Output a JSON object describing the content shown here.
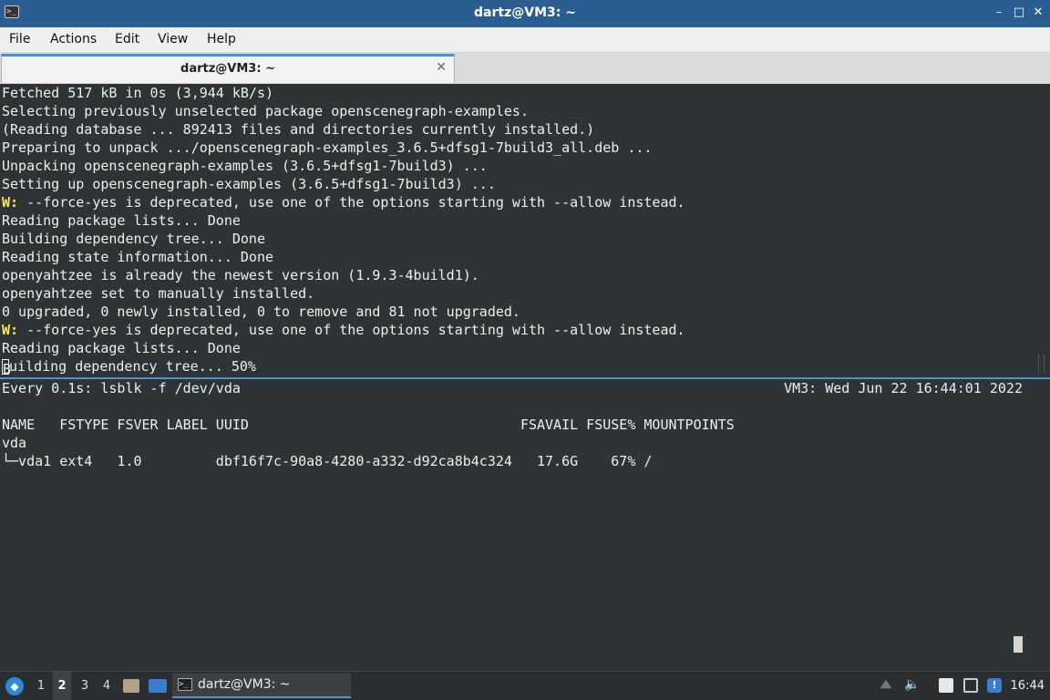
{
  "window": {
    "title": "dartz@VM3: ~",
    "minimize": "–",
    "maximize": "□",
    "close": "✕"
  },
  "menu": [
    "File",
    "Actions",
    "Edit",
    "View",
    "Help"
  ],
  "tab": {
    "label": "dartz@VM3: ~",
    "close": "✕"
  },
  "top_pane": {
    "lines": [
      {
        "text": "Fetched 517 kB in 0s (3,944 kB/s)"
      },
      {
        "text": "Selecting previously unselected package openscenegraph-examples."
      },
      {
        "text": "(Reading database ... 892413 files and directories currently installed.)"
      },
      {
        "text": "Preparing to unpack .../openscenegraph-examples_3.6.5+dfsg1-7build3_all.deb ..."
      },
      {
        "text": "Unpacking openscenegraph-examples (3.6.5+dfsg1-7build3) ..."
      },
      {
        "text": "Setting up openscenegraph-examples (3.6.5+dfsg1-7build3) ..."
      },
      {
        "prefix": "W:",
        "text": " --force-yes is deprecated, use one of the options starting with --allow instead."
      },
      {
        "text": "Reading package lists... Done"
      },
      {
        "text": "Building dependency tree... Done"
      },
      {
        "text": "Reading state information... Done"
      },
      {
        "text": "openyahtzee is already the newest version (1.9.3-4build1)."
      },
      {
        "text": "openyahtzee set to manually installed."
      },
      {
        "text": "0 upgraded, 0 newly installed, 0 to remove and 81 not upgraded."
      },
      {
        "prefix": "W:",
        "text": " --force-yes is deprecated, use one of the options starting with --allow instead."
      },
      {
        "text": "Reading package lists... Done"
      }
    ],
    "last_line_cursor_char": "B",
    "last_line_rest": "uilding dependency tree... 50%"
  },
  "bottom_pane": {
    "watch_command": "Every 0.1s: lsblk -f /dev/vda",
    "watch_status": "VM3: Wed Jun 22 16:44:01 2022",
    "table_header": "NAME   FSTYPE FSVER LABEL UUID                                 FSAVAIL FSUSE% MOUNTPOINTS",
    "rows": [
      "vda",
      "└─vda1 ext4   1.0         dbf16f7c-90a8-4280-a332-d92ca8b4c324   17.6G    67% /"
    ]
  },
  "taskbar": {
    "workspaces": [
      "1",
      "2",
      "3",
      "4"
    ],
    "active_workspace": "2",
    "task_label": "dartz@VM3: ~",
    "clock": "16:44",
    "icons": [
      "start-menu-icon",
      "file-manager-icon",
      "show-desktop-icon",
      "terminal-icon",
      "tray-arrow-icon",
      "volume-icon",
      "clipboard-icon",
      "network-icon",
      "notification-icon"
    ]
  }
}
